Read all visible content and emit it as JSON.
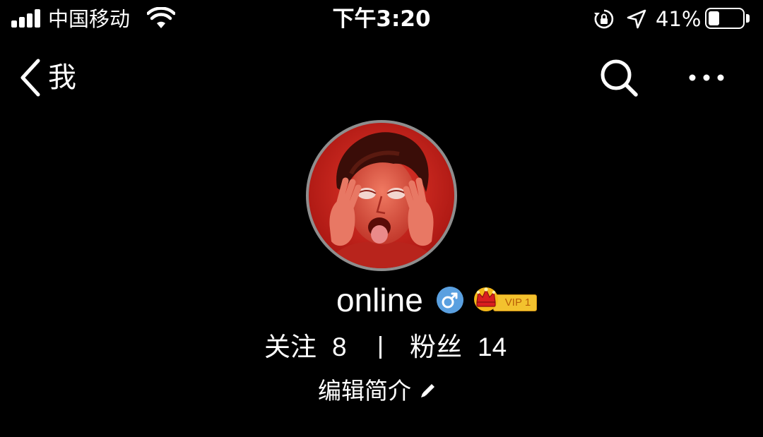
{
  "status_bar": {
    "carrier": "中国移动",
    "time": "下午3:20",
    "battery_percent": "41%",
    "battery_level": 0.41,
    "icons": [
      "signal-icon",
      "wifi-icon",
      "rotation-lock-icon",
      "location-arrow-icon",
      "battery-icon"
    ]
  },
  "nav": {
    "back_label": "我",
    "icons": [
      "back-chevron-icon",
      "search-icon",
      "more-icon"
    ]
  },
  "profile": {
    "username": "online",
    "gender_symbol": "♂",
    "vip_label": "VIP 1",
    "following_label": "关注",
    "following_count": "8",
    "divider": "|",
    "fans_label": "粉丝",
    "fans_count": "14",
    "edit_bio_label": "编辑简介"
  },
  "colors": {
    "background": "#000000",
    "text": "#ffffff",
    "gender_badge": "#5aa0e0",
    "vip_gold": "#f3c22e",
    "avatar_ring": "#8e8e8e"
  }
}
